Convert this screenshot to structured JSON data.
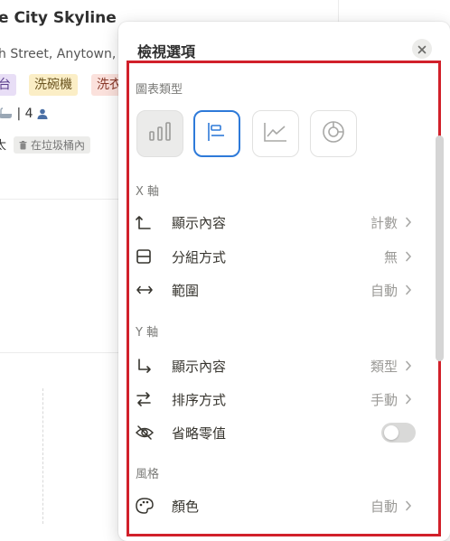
{
  "background": {
    "title": "e City Skyline",
    "address": "h Street, Anytown, C",
    "tags": [
      "台",
      "洗碗機",
      "洗衣"
    ],
    "meta_count": "| 4",
    "owner": "太",
    "trash_label": "在垃圾桶內"
  },
  "popup": {
    "title": "檢視選項",
    "chart_type_label": "圖表類型",
    "chart_types": [
      {
        "name": "vertical-bar",
        "selected": false
      },
      {
        "name": "horizontal-bar",
        "selected": true
      },
      {
        "name": "line",
        "selected": false
      },
      {
        "name": "donut",
        "selected": false
      }
    ],
    "x_axis": {
      "label": "X 軸",
      "rows": [
        {
          "label": "顯示內容",
          "value": "計數"
        },
        {
          "label": "分組方式",
          "value": "無"
        },
        {
          "label": "範圍",
          "value": "自動"
        }
      ]
    },
    "y_axis": {
      "label": "Y 軸",
      "rows": [
        {
          "label": "顯示內容",
          "value": "類型"
        },
        {
          "label": "排序方式",
          "value": "手動"
        },
        {
          "label": "省略零值",
          "toggle": false
        }
      ]
    },
    "style": {
      "label": "風格",
      "rows": [
        {
          "label": "顏色",
          "value": "自動"
        }
      ]
    }
  },
  "colors": {
    "accent": "#2e7ad9",
    "highlight_border": "#d1202a"
  }
}
